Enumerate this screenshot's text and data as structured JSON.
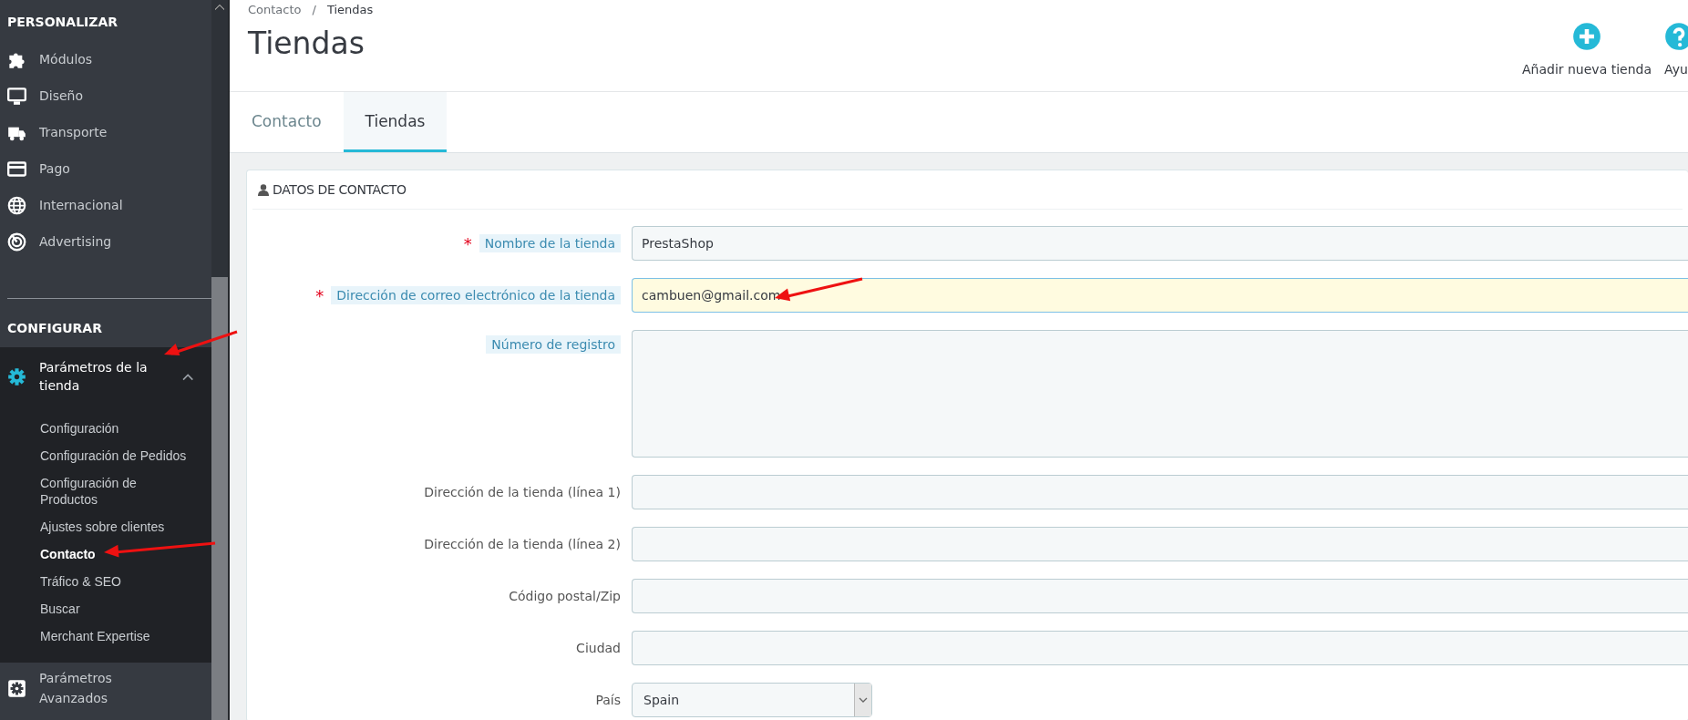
{
  "sidebar": {
    "sections": [
      {
        "title": "PERSONALIZAR",
        "items": [
          {
            "label": "Módulos",
            "expanded": false
          },
          {
            "label": "Diseño",
            "expanded": false
          },
          {
            "label": "Transporte",
            "expanded": false
          },
          {
            "label": "Pago",
            "expanded": false
          },
          {
            "label": "Internacional",
            "expanded": false
          },
          {
            "label": "Advertising",
            "expanded": false
          }
        ]
      },
      {
        "title": "CONFIGURAR",
        "items": [
          {
            "label": "Parámetros de la tienda",
            "expanded": true,
            "children": [
              {
                "label": "Configuración",
                "selected": false
              },
              {
                "label": "Configuración de Pedidos",
                "selected": false
              },
              {
                "label": "Configuración de Productos",
                "selected": false
              },
              {
                "label": "Ajustes sobre clientes",
                "selected": false
              },
              {
                "label": "Contacto",
                "selected": true
              },
              {
                "label": "Tráfico & SEO",
                "selected": false
              },
              {
                "label": "Buscar",
                "selected": false
              },
              {
                "label": "Merchant Expertise",
                "selected": false
              }
            ]
          },
          {
            "label": "Parámetros Avanzados",
            "expanded": false
          }
        ]
      }
    ]
  },
  "breadcrumb": {
    "separator": "/",
    "items": [
      "Contacto",
      "Tiendas"
    ]
  },
  "page_title": "Tiendas",
  "actions": [
    {
      "label": "Añadir nueva tienda"
    },
    {
      "label": "Ayu"
    }
  ],
  "tabs": [
    {
      "label": "Contacto",
      "selected": false
    },
    {
      "label": "Tiendas",
      "selected": true
    }
  ],
  "panel": {
    "title": "DATOS DE CONTACTO",
    "fields": [
      {
        "label": "Nombre de la tienda",
        "kind": "text",
        "required_mark": "*",
        "hint": true,
        "value": "PrestaShop",
        "focused": false
      },
      {
        "label": "Dirección de correo electrónico de la tienda",
        "kind": "text",
        "required_mark": "*",
        "hint": true,
        "value": "cambuen@gmail.com",
        "focused": true
      },
      {
        "label": "Número de registro",
        "kind": "textarea",
        "hint": true,
        "focused": false
      },
      {
        "label": "Dirección de la tienda (línea 1)",
        "kind": "text",
        "hint": false,
        "focused": false
      },
      {
        "label": "Dirección de la tienda (línea 2)",
        "kind": "text",
        "hint": false,
        "focused": false
      },
      {
        "label": "Código postal/Zip",
        "kind": "text",
        "hint": false,
        "focused": false
      },
      {
        "label": "Ciudad",
        "kind": "text",
        "hint": false,
        "focused": false
      },
      {
        "label": "País",
        "kind": "select",
        "hint": false,
        "value": "Spain",
        "focused": false
      }
    ]
  }
}
